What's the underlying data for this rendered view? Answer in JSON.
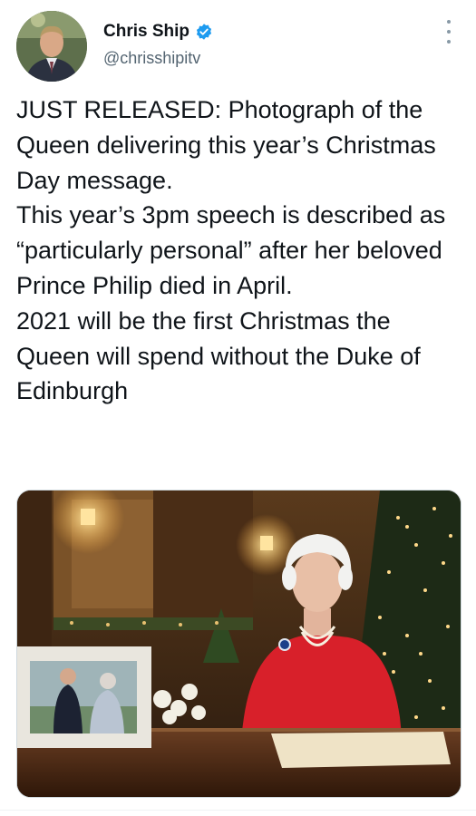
{
  "author": {
    "name": "Chris Ship",
    "handle": "@chrisshipitv",
    "verified": true,
    "avatar_icon": "profile-photo"
  },
  "tweet": {
    "paragraphs": [
      "JUST RELEASED: Photograph of the Queen delivering this year’s Christmas Day message.",
      "This year’s 3pm speech is described as “particularly personal” after her beloved Prince Philip died in April.",
      "2021 will be the first Christmas the Queen will spend without the Duke of Edinburgh"
    ]
  },
  "media": {
    "type": "photo"
  },
  "colors": {
    "text": "#0f1419",
    "secondary": "#536471",
    "verified_blue": "#1d9bf0",
    "dress_red": "#d8202a"
  },
  "icons": {
    "verified": "verified-badge-icon",
    "more": "more-options-icon"
  }
}
